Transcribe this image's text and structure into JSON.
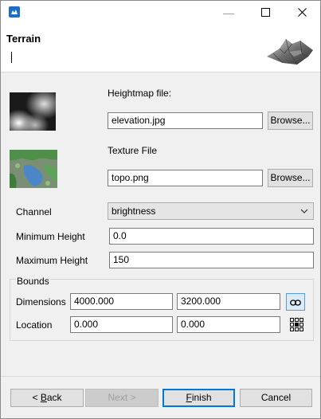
{
  "window": {
    "title_icon": "app-icon",
    "minimize_glyph": "—",
    "maximize_glyph": "☐",
    "close_glyph": "✕"
  },
  "header": {
    "title": "Terrain",
    "logo_icon": "terrain-logo-icon"
  },
  "heightmap": {
    "label": "Heightmap file:",
    "value": "elevation.jpg",
    "browse_label": "Browse..."
  },
  "texture": {
    "label": "Texture File",
    "value": "topo.png",
    "browse_label": "Browse..."
  },
  "channel": {
    "label": "Channel",
    "value": "brightness"
  },
  "min_height": {
    "label": "Minimum Height",
    "value": "0.0"
  },
  "max_height": {
    "label": "Maximum Height",
    "value": "150"
  },
  "bounds": {
    "group_label": "Bounds",
    "dimensions_label": "Dimensions",
    "dim_x": "4000.000",
    "dim_y": "3200.000",
    "link_icon": "link-icon",
    "location_label": "Location",
    "loc_x": "0.000",
    "loc_y": "0.000",
    "anchor_icon": "anchor-grid-icon"
  },
  "footer": {
    "back_prefix": "< ",
    "back_mnemonic": "B",
    "back_rest": "ack",
    "next_label": "Next >",
    "finish_mnemonic": "F",
    "finish_rest": "inish",
    "cancel_label": "Cancel"
  },
  "colors": {
    "accent": "#0078d7",
    "window_bg": "#f0f0f0",
    "header_bg": "#ffffff"
  }
}
